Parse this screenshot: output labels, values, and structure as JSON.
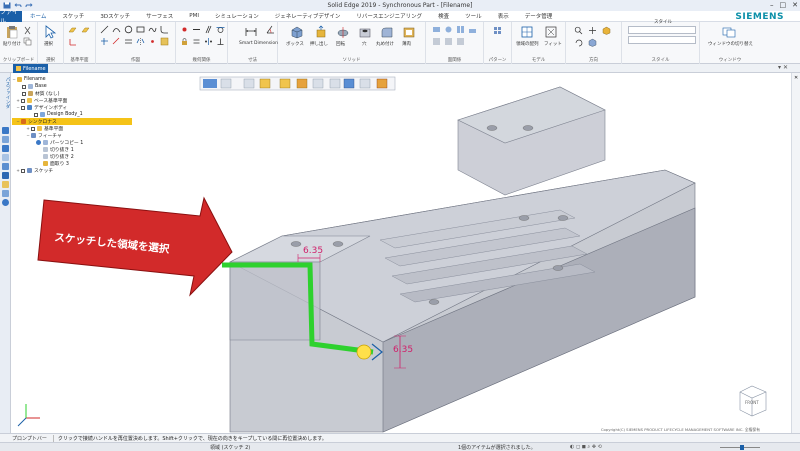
{
  "app": {
    "title": "Solid Edge 2019 - Synchronous Part - [Filename]",
    "brand": "SIEMENS"
  },
  "menu": {
    "file": "ファイル",
    "tabs": [
      "ホーム",
      "スケッチ",
      "3Dスケッチ",
      "サーフェス",
      "PMI",
      "シミュレーション",
      "ジェネレーティブデザイン",
      "リバースエンジニアリング",
      "検査",
      "ツール",
      "表示",
      "データ管理"
    ]
  },
  "ribbon": {
    "groups": [
      "クリップボード",
      "選択",
      "基準平面",
      "作図",
      "幾何関係",
      "寸法",
      "ソリッド",
      "面関係",
      "パターン",
      "モデル",
      "方向",
      "スタイル",
      "ウィンドウ"
    ],
    "buttons": {
      "paste": "貼り付け",
      "select": "選択",
      "smart_dimension": "Smart Dimension",
      "extrude": "押し出し",
      "boxes": "ボックス",
      "revolve": "回転",
      "hole": "穴",
      "round": "丸め付け",
      "thin": "薄肉",
      "view_orient": "領域の配列",
      "fit": "フィット",
      "style_label": "スタイル",
      "window": "ウィンドウの切り替え"
    }
  },
  "document": {
    "tab": "Filename"
  },
  "tree": {
    "items": [
      {
        "label": "Filename",
        "level": 0,
        "icon": "part-icon"
      },
      {
        "label": "Base",
        "level": 1,
        "icon": "base-icon"
      },
      {
        "label": "材質 (なし)",
        "level": 1,
        "icon": "material-icon"
      },
      {
        "label": "ベース基準平面",
        "level": 1,
        "icon": "plane-icon"
      },
      {
        "label": "デザインボディ",
        "level": 1,
        "icon": "body-icon"
      },
      {
        "label": "Design Body_1",
        "level": 2,
        "icon": "body-icon"
      },
      {
        "label": "シンクロナス",
        "level": 1,
        "icon": "sync-icon"
      },
      {
        "label": "基準平面",
        "level": 2,
        "icon": "plane-icon"
      },
      {
        "label": "フィーチャ",
        "level": 2,
        "icon": "feature-icon"
      },
      {
        "label": "パーツコピー 1",
        "level": 3,
        "icon": "copy-icon"
      },
      {
        "label": "切り抜き 1",
        "level": 3,
        "icon": "cut-icon"
      },
      {
        "label": "切り抜き 2",
        "level": 3,
        "icon": "cut-icon"
      },
      {
        "label": "面取り 3",
        "level": 3,
        "icon": "chamfer-icon"
      },
      {
        "label": "スケッチ",
        "level": 1,
        "icon": "sketch-icon"
      }
    ]
  },
  "rail": {
    "label": "パスファインダ"
  },
  "viewport": {
    "callout": "スケッチした領域を選択",
    "dim1": "6.35",
    "dim2": "6.35",
    "cube_label": "FRONT"
  },
  "prompt": {
    "label": "プロンプトバー",
    "text": "クリックで接続ハンドルを再位置決めします。Shift+クリックで、現在の向きをキープしている間に再位置決めします。"
  },
  "copyright": "Copyright(C) SIEMENS PRODUCT LIFECYCLE MANAGEMENT SOFTWARE INC. 全権保有",
  "status": {
    "left": "領域 (スケッチ 2)",
    "mid": "1個のアイテムが選択されました。"
  },
  "colors": {
    "accent": "#1a5fa8",
    "sketch_green": "#2ed12e",
    "dim_magenta": "#d0206a",
    "callout_red": "#d22a2a",
    "model_gray": "#b9bcc6"
  }
}
